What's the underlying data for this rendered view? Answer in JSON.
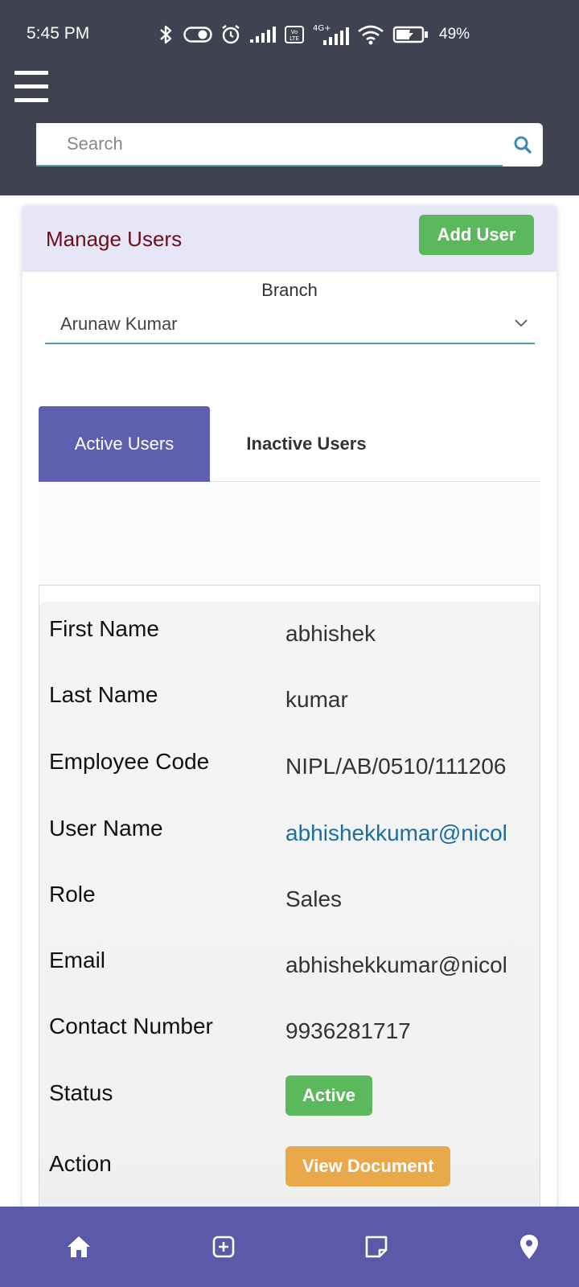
{
  "status_bar": {
    "time": "5:45 PM",
    "network_label": "4G+",
    "volte_label": "Vo LTE",
    "battery_percent": "49%"
  },
  "search": {
    "placeholder": "Search"
  },
  "card": {
    "title": "Manage Users",
    "add_user_label": "Add User"
  },
  "branch": {
    "label": "Branch",
    "selected": "Arunaw Kumar"
  },
  "tabs": [
    {
      "label": "Active Users",
      "active": true
    },
    {
      "label": "Inactive Users",
      "active": false
    }
  ],
  "user": {
    "rows": [
      {
        "label": "First Name",
        "value": "abhishek"
      },
      {
        "label": "Last Name",
        "value": "kumar"
      },
      {
        "label": "Employee Code",
        "value": "NIPL/AB/0510/111206"
      },
      {
        "label": "User Name",
        "value": "abhishekkumar@nicol"
      },
      {
        "label": "Role",
        "value": "Sales"
      },
      {
        "label": "Email",
        "value": "abhishekkumar@nicol"
      },
      {
        "label": "Contact Number",
        "value": "9936281717"
      },
      {
        "label": "Status",
        "value": "Active"
      },
      {
        "label": "Action",
        "value": "View Document"
      }
    ]
  },
  "bottom_nav": {
    "items": [
      "home-icon",
      "add-box-icon",
      "note-icon",
      "location-pin-icon"
    ]
  },
  "colors": {
    "topbar": "#3f4250",
    "header_bg": "#e6e6f7",
    "title": "#6b0f1a",
    "success": "#5cb85c",
    "tab_active": "#5f5fb0",
    "warning": "#e9a94a",
    "link": "#1a6ea0",
    "bottom_nav": "#5a5aa8"
  }
}
